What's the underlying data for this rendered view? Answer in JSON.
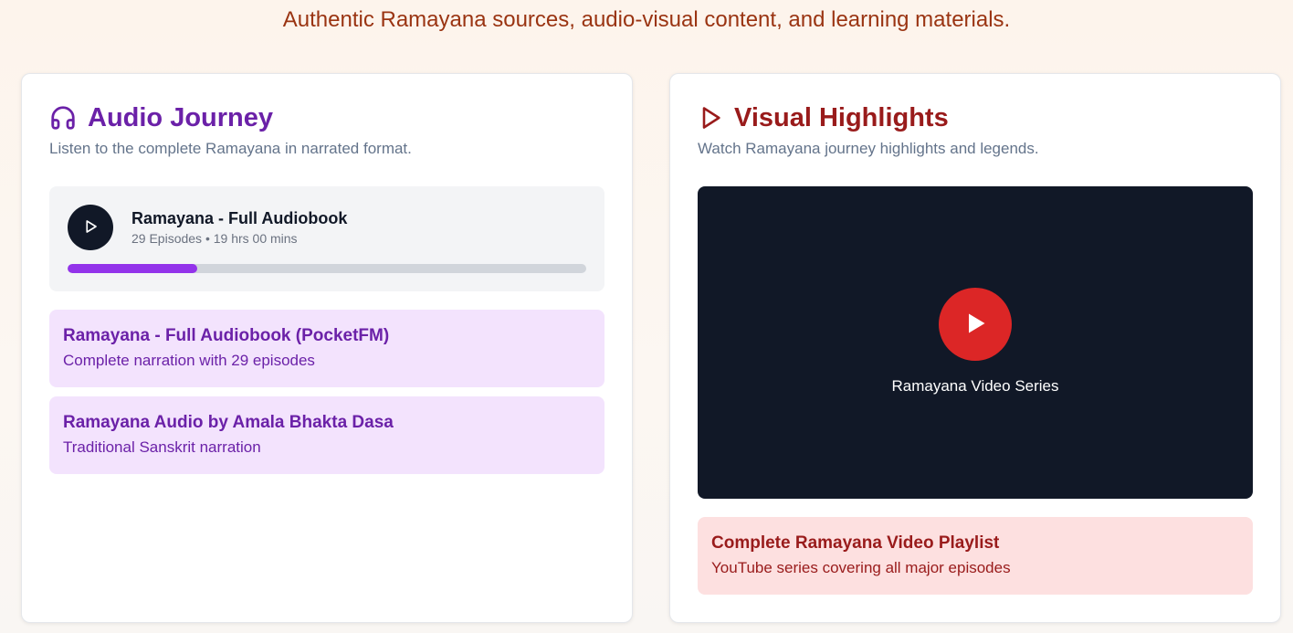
{
  "tagline": "Authentic Ramayana sources, audio-visual content, and learning materials.",
  "audio": {
    "title": "Audio Journey",
    "icon": "headphones-icon",
    "subtitle": "Listen to the complete Ramayana in narrated format.",
    "player": {
      "title": "Ramayana - Full Audiobook",
      "meta": "29 Episodes • 19 hrs 00 mins",
      "progress": 0.25
    },
    "links": [
      {
        "title": "Ramayana - Full Audiobook (PocketFM)",
        "desc": "Complete narration with 29 episodes"
      },
      {
        "title": "Ramayana Audio by Amala Bhakta Dasa",
        "desc": "Traditional Sanskrit narration"
      }
    ]
  },
  "visual": {
    "title": "Visual Highlights",
    "icon": "play-icon",
    "subtitle": "Watch Ramayana journey highlights and legends.",
    "video": {
      "caption": "Ramayana Video Series"
    },
    "links": [
      {
        "title": "Complete Ramayana Video Playlist",
        "desc": "YouTube series covering all major episodes"
      }
    ]
  },
  "colors": {
    "audio_accent": "#6b21a8",
    "progress": "#9333ea",
    "visual_accent": "#991b1b",
    "video_play": "#dc2626"
  }
}
